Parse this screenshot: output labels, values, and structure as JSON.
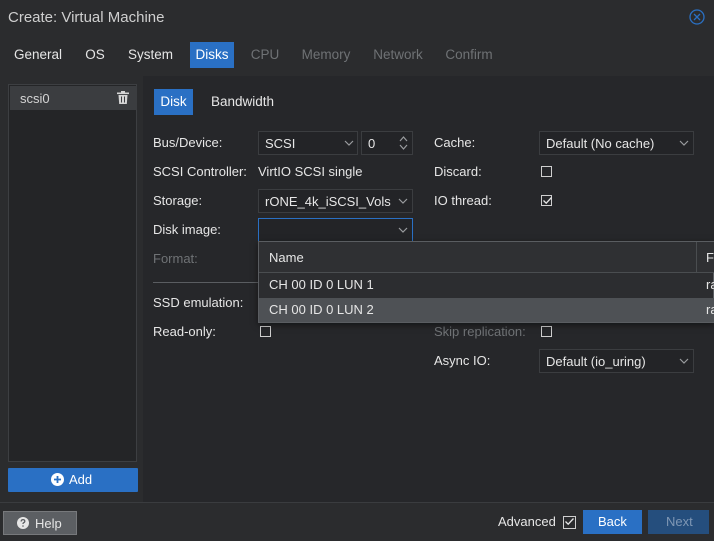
{
  "window": {
    "title": "Create: Virtual Machine"
  },
  "tabs": [
    {
      "label": "General",
      "state": "normal"
    },
    {
      "label": "OS",
      "state": "normal"
    },
    {
      "label": "System",
      "state": "normal"
    },
    {
      "label": "Disks",
      "state": "active"
    },
    {
      "label": "CPU",
      "state": "disabled"
    },
    {
      "label": "Memory",
      "state": "disabled"
    },
    {
      "label": "Network",
      "state": "disabled"
    },
    {
      "label": "Confirm",
      "state": "disabled"
    }
  ],
  "disk_list": {
    "items": [
      {
        "label": "scsi0"
      }
    ],
    "add_label": "Add"
  },
  "subtabs": {
    "disk": "Disk",
    "bandwidth": "Bandwidth"
  },
  "form": {
    "bus_device_label": "Bus/Device:",
    "bus_value": "SCSI",
    "device_number": "0",
    "scsi_controller_label": "SCSI Controller:",
    "scsi_controller_value": "VirtIO SCSI single",
    "storage_label": "Storage:",
    "storage_value": "rONE_4k_iSCSI_Vols",
    "disk_image_label": "Disk image:",
    "disk_image_value": "",
    "format_label": "Format:",
    "ssd_emulation_label": "SSD emulation:",
    "read_only_label": "Read-only:",
    "cache_label": "Cache:",
    "cache_value": "Default (No cache)",
    "discard_label": "Discard:",
    "io_thread_label": "IO thread:",
    "skip_replication_label": "Skip replication:",
    "async_io_label": "Async IO:",
    "async_io_value": "Default (io_uring)"
  },
  "checkboxes": {
    "discard": false,
    "io_thread": true,
    "skip_replication": false,
    "read_only": false,
    "advanced": true
  },
  "dropdown": {
    "column_name": "Name",
    "column_format_partial": "F",
    "rows": [
      {
        "name": "CH 00 ID 0 LUN 1",
        "format_partial": "ra",
        "selected": false
      },
      {
        "name": "CH 00 ID 0 LUN 2",
        "format_partial": "ra",
        "selected": true
      }
    ]
  },
  "footer": {
    "help_label": "Help",
    "advanced_label": "Advanced",
    "back_label": "Back",
    "next_label": "Next"
  },
  "colors": {
    "accent": "#2a70c4",
    "background": "#2b2c2e",
    "panel": "#26272a",
    "text": "#e6e6e6",
    "disabled_text": "#6f7275"
  }
}
